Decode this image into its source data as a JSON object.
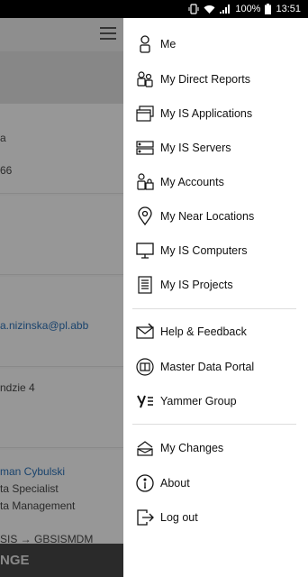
{
  "status_bar": {
    "battery": "100%",
    "time": "13:51"
  },
  "background": {
    "partial_texts": [
      "a",
      "66",
      "a.nizinska@pl.abb",
      "ndzie 4",
      "man Cybulski",
      "ta Specialist",
      "ta Management",
      "SIS → GBSISMDM"
    ],
    "bottom_button": "NGE"
  },
  "drawer": {
    "items": [
      {
        "label": "Me",
        "icon": "person-icon"
      },
      {
        "label": "My Direct Reports",
        "icon": "people-icon"
      },
      {
        "label": "My IS Applications",
        "icon": "applications-icon"
      },
      {
        "label": "My IS Servers",
        "icon": "server-icon"
      },
      {
        "label": "My Accounts",
        "icon": "account-icon"
      },
      {
        "label": "My Near Locations",
        "icon": "location-pin-icon"
      },
      {
        "label": "My IS Computers",
        "icon": "monitor-icon"
      },
      {
        "label": "My IS Projects",
        "icon": "document-icon"
      },
      {
        "label": "Help & Feedback",
        "icon": "mail-icon"
      },
      {
        "label": "Master Data Portal",
        "icon": "portal-icon"
      },
      {
        "label": "Yammer Group",
        "icon": "yammer-icon"
      },
      {
        "label": "My Changes",
        "icon": "changes-icon"
      },
      {
        "label": "About",
        "icon": "info-icon"
      },
      {
        "label": "Log out",
        "icon": "logout-icon"
      }
    ]
  }
}
